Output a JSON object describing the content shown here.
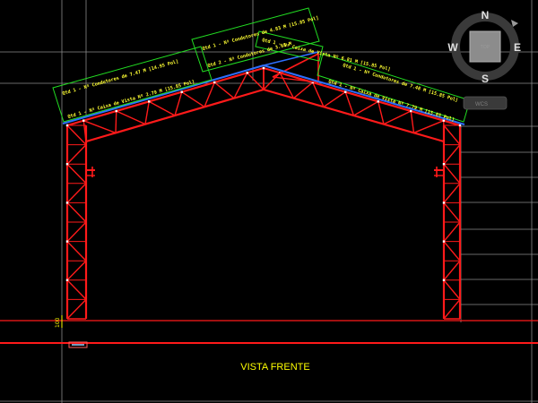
{
  "drawing": {
    "view_title": "VISTA FRENTE",
    "dimension_label": "100",
    "annotations": {
      "left_low": "Qtd 1 - Nº Caixa de Vista Nº 2.79 M [15.85 Pol]",
      "left_high": "Qtd 1 - Nº Condutores de 7.47 M [14.95 Pol]",
      "ridge_left": "Qtd 1 - Nº Condutores de 4.83 M [15.85 Pol]",
      "ridge_center": "Qtd 2 - Nº Condutores de 3.65 M",
      "ridge_right": "Qtd 1 - Nº Caixa de Vista Nº 6.81 M [15.85 Pol]",
      "right_high": "Qtd 1 - Nº Condutores de 7.48 M [15.85 Pol]",
      "right_low": "Qtd 1 - Nº Caixa de Vista Nº 7.79 M [15.85 Pol]"
    }
  },
  "viewcube": {
    "north": "N",
    "south": "S",
    "east": "E",
    "west": "W",
    "top_face": "TOP",
    "wcs_label": "WCS"
  },
  "colors": {
    "background": "#000000",
    "truss": "#ff1a1a",
    "roof_line": "#2f6fff",
    "annotation_box": "#22dd22",
    "annotation_text": "#ffff33",
    "grid": "#8a8a8a"
  }
}
